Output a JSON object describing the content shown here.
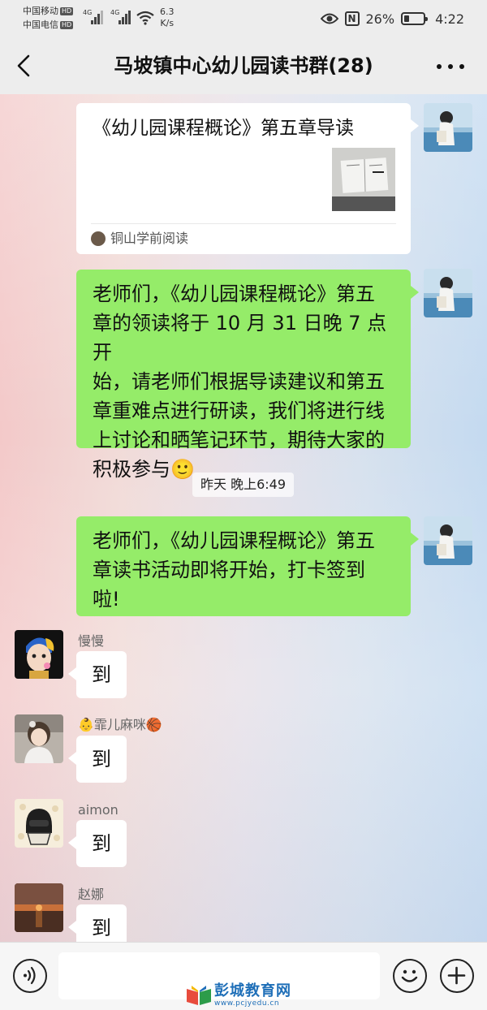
{
  "status_bar": {
    "carrier1": "中国移动",
    "carrier2": "中国电信",
    "hd_badge": "HD",
    "signal_label": "4G",
    "speed_value": "6.3",
    "speed_unit": "K/s",
    "nfc_icon": "N",
    "battery_percent": "26%",
    "battery_level": 0.26,
    "time": "4:22"
  },
  "nav": {
    "title": "马坡镇中心幼儿园读书群(28)",
    "back_icon": "chevron-left-icon",
    "more_icon": "more-dots-icon"
  },
  "messages": {
    "link_card": {
      "title": "《幼儿园课程概论》第五章导读",
      "source": "铜山学前阅读"
    },
    "msg1": {
      "lines": [
        "老师们，《幼儿园课程概论》第五",
        "章的领读将于 10 月 31 日晚 7 点开",
        "始，请老师们根据导读建议和第五",
        "章重难点进行研读，我们将进行线",
        "上讨论和晒笔记环节，期待大家的"
      ],
      "last_line": "积极参与",
      "emoji": "🙂"
    },
    "timestamp": "昨天 晚上6:49",
    "msg2": {
      "lines": [
        "老师们，《幼儿园课程概论》第五",
        "章读书活动即将开始，打卡签到",
        "啦!"
      ]
    },
    "replies": [
      {
        "name": "慢慢",
        "text": "到"
      },
      {
        "name": "👶霏儿麻咪🏀",
        "text": "到"
      },
      {
        "name": "aimon",
        "text": "到"
      },
      {
        "name": "赵娜",
        "text": "到"
      }
    ]
  },
  "input_bar": {
    "voice_icon": "voice-icon",
    "emoji_icon": "emoji-icon",
    "plus_icon": "plus-icon"
  },
  "watermark": {
    "text": "彭城教育网",
    "url": "www.pcjyedu.cn"
  },
  "colors": {
    "self_bubble": "#95ec69",
    "other_bubble": "#ffffff",
    "bar_bg": "#ededed"
  }
}
